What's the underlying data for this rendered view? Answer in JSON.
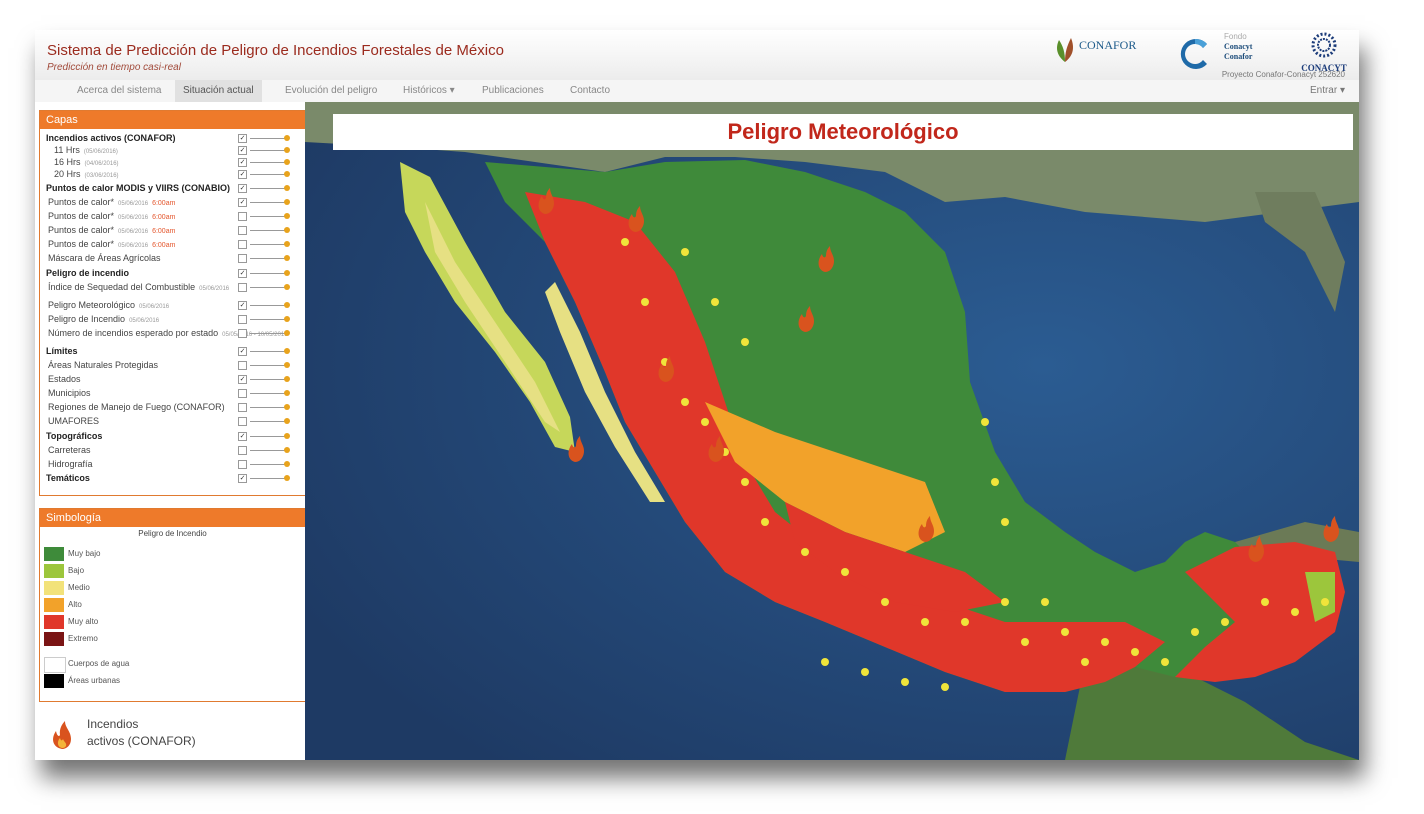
{
  "header": {
    "title": "Sistema de Predicción de Peligro de Incendios Forestales de México",
    "subtitle": "Predicción en tiempo casi-real",
    "logos": {
      "conafor": "CONAFOR",
      "fondo": "Fondo",
      "conacyt_1": "Conacyt",
      "conafor_2": "Conafor",
      "conacyt_main": "CONACYT",
      "proyecto": "Proyecto Conafor-Conacyt 252620"
    }
  },
  "nav": {
    "items": [
      "Acerca del sistema",
      "Situación actual",
      "Evolución del peligro",
      "Históricos ▾",
      "Publicaciones",
      "Contacto"
    ],
    "active_index": 1,
    "entrar": "Entrar ▾"
  },
  "capas": {
    "title": "Capas",
    "layers": [
      {
        "label": "Incendios activos (CONAFOR)",
        "group": true,
        "checked": true
      },
      {
        "label": "11 Hrs",
        "date": "(05/06/2016)",
        "checked": true
      },
      {
        "label": "16 Hrs",
        "date": "(04/06/2016)",
        "checked": true
      },
      {
        "label": "20 Hrs",
        "date": "(03/06/2016)",
        "checked": true
      },
      {
        "label": "Puntos de calor MODIS y VIIRS (CONABIO)",
        "group": true,
        "checked": true
      },
      {
        "label": "Puntos de calor*",
        "date": "05/06/2016",
        "time": "6:00am",
        "checked": true
      },
      {
        "label": "Puntos de calor*",
        "date": "05/06/2016",
        "time": "6:00am",
        "checked": false
      },
      {
        "label": "Puntos de calor*",
        "date": "05/06/2016",
        "time": "6:00am",
        "checked": false
      },
      {
        "label": "Puntos de calor*",
        "date": "05/06/2016",
        "time": "6:00am",
        "checked": false
      },
      {
        "label": "Máscara de Áreas Agrícolas",
        "checked": false
      },
      {
        "label": "Peligro de incendio",
        "group": true,
        "checked": true
      },
      {
        "label": "Índice de Sequedad del Combustible",
        "date": "05/06/2016",
        "checked": false
      },
      {
        "label": "Peligro Meteorológico",
        "date": "05/06/2016",
        "checked": true
      },
      {
        "label": "Peligro de Incendio",
        "date": "05/06/2016",
        "checked": false
      },
      {
        "label": "Número de incendios esperado por estado",
        "date": "05/05/2016 - 10/05/2016",
        "checked": false
      },
      {
        "label": "Límites",
        "group": true,
        "checked": true
      },
      {
        "label": "Áreas Naturales Protegidas",
        "checked": false
      },
      {
        "label": "Estados",
        "checked": true
      },
      {
        "label": "Municipios",
        "checked": false
      },
      {
        "label": "Regiones de Manejo de Fuego (CONAFOR)",
        "checked": false
      },
      {
        "label": "UMAFORES",
        "checked": false
      },
      {
        "label": "Topográficos",
        "group": true,
        "checked": true
      },
      {
        "label": "Carreteras",
        "checked": false
      },
      {
        "label": "Hidrografía",
        "checked": false
      },
      {
        "label": "Temáticos",
        "group": true,
        "checked": true
      }
    ]
  },
  "simbologia": {
    "title": "Simbología",
    "subtitle": "Peligro de Incendio",
    "items": [
      {
        "label": "Muy bajo",
        "color": "#3e8b3a"
      },
      {
        "label": "Bajo",
        "color": "#9cc63c"
      },
      {
        "label": "Medio",
        "color": "#f2e27a"
      },
      {
        "label": "Alto",
        "color": "#f2a22a"
      },
      {
        "label": "Muy alto",
        "color": "#e0372a"
      },
      {
        "label": "Extremo",
        "color": "#7a1414"
      },
      {
        "label": "Cuerpos de agua",
        "color": "#ffffff"
      },
      {
        "label": "Áreas urbanas",
        "color": "#000000"
      }
    ],
    "fire_label_1": "Incendios",
    "fire_label_2": "activos (CONAFOR)"
  },
  "map": {
    "title": "Peligro Meteorológico"
  }
}
